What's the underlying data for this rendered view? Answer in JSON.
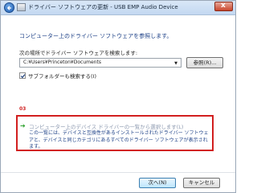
{
  "window": {
    "title": "ドライバー ソフトウェアの更新 - USB EMP Audio Device",
    "close_glyph": "x"
  },
  "main": {
    "heading": "コンピューター上のドライバー ソフトウェアを参照します。",
    "search_label": "次の場所でドライバー ソフトウェアを検索します:",
    "path_value": "C:¥Users¥Princeton¥Documents",
    "path_dropdown_glyph": "▼",
    "browse_label": "参照(R)...",
    "subfolder_label": "サブフォルダーも検索する(I)",
    "step_badge": "03",
    "pick": {
      "title": "コンピューター上のデバイス ドライバーの一覧から選択します(L)",
      "description": "この一覧には、デバイスと互換性があるインストールされたドライバー ソフトウェアと、デバイスと同じカテゴリにあるすべてのドライバー ソフトウェアが表示されます。"
    }
  },
  "footer": {
    "next_label": "次へ(N)",
    "cancel_label": "キャンセル"
  },
  "colors": {
    "accent_text": "#1b3f86",
    "highlight_border": "#d21f1f",
    "arrow_green": "#2aa02a"
  },
  "icons": {
    "back": "back-arrow-icon",
    "app": "device-manager-icon",
    "close": "close-icon",
    "check": "checkmark-icon",
    "arrow": "green-arrow-icon"
  }
}
